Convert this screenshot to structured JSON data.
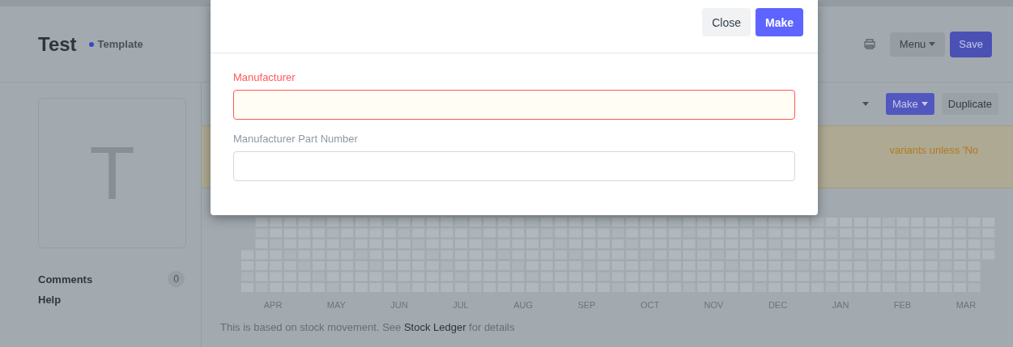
{
  "header": {
    "title": "Test",
    "status": "Template",
    "menu_button": "Menu",
    "save_button": "Save"
  },
  "sidebar": {
    "avatar_letter": "T",
    "items": [
      {
        "label": "Comments",
        "count": "0"
      },
      {
        "label": "Help"
      }
    ]
  },
  "toolbar": {
    "make_button": "Make",
    "duplicate_button": "Duplicate"
  },
  "alert": {
    "text": "variants unless 'No"
  },
  "heatmap": {
    "months": [
      "APR",
      "MAY",
      "JUN",
      "JUL",
      "AUG",
      "SEP",
      "OCT",
      "NOV",
      "DEC",
      "JAN",
      "FEB",
      "MAR"
    ]
  },
  "note": {
    "before": "This is based on stock movement. See ",
    "link": "Stock Ledger",
    "after": " for details"
  },
  "dialog": {
    "buttons": [
      {
        "label": "Close",
        "kind": "secondary"
      },
      {
        "label": "Make",
        "kind": "primary"
      }
    ],
    "fields": [
      {
        "label": "Manufacturer",
        "error": true
      },
      {
        "label": "Manufacturer Part Number",
        "error": false
      }
    ]
  }
}
